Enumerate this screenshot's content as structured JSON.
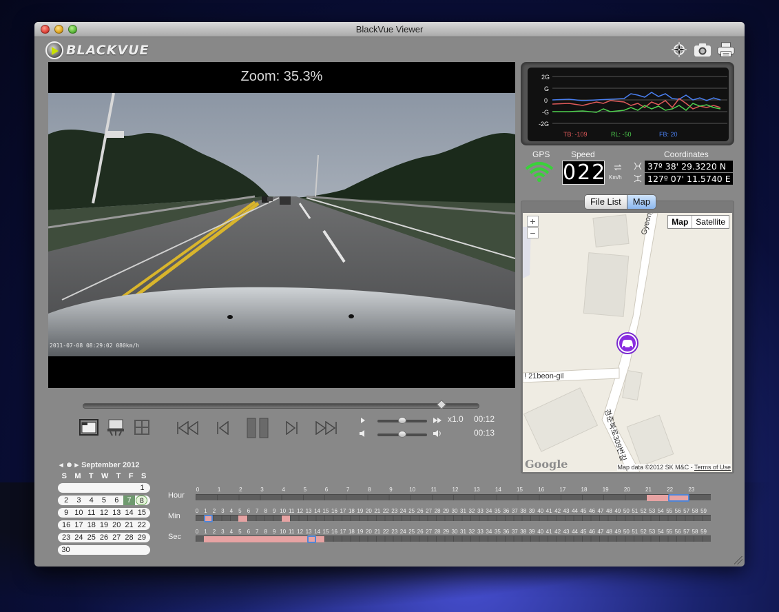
{
  "window": {
    "title": "BlackVue Viewer"
  },
  "brand": {
    "logo_text": "BLACKVUE"
  },
  "toolbar": {
    "icons": [
      "crosshair-icon",
      "camera-icon",
      "printer-icon"
    ]
  },
  "video": {
    "zoom_label": "Zoom: 35.3%",
    "overlay_stamp": "2011-07-08 08:29:02  080km/h"
  },
  "playback": {
    "position_fraction": 0.91,
    "speed_label": "x1.0",
    "current_time": "00:12",
    "total_time": "00:13",
    "speed_slider_fraction": 0.5,
    "volume_slider_fraction": 0.5
  },
  "gsensor": {
    "y_tick_labels": [
      "2G",
      "G",
      "0",
      "-G",
      "-2G"
    ],
    "readouts": [
      {
        "label": "TB: -109",
        "color": "#e05a5a"
      },
      {
        "label": "RL: -50",
        "color": "#4fcf4f"
      },
      {
        "label": "FB: 20",
        "color": "#4a7ff0"
      }
    ]
  },
  "gps": {
    "gps_label": "GPS",
    "speed_label": "Speed",
    "speed_value": "022",
    "speed_unit": "Km/h",
    "coords_label": "Coordinates",
    "latitude": "37º 38' 29.3220 N",
    "longitude": "127º 07' 11.5740 E"
  },
  "panel_tabs": {
    "file_list": "File List",
    "map": "Map",
    "active": "Map"
  },
  "map": {
    "zoom_in": "+",
    "zoom_out": "−",
    "type_map": "Map",
    "type_satellite": "Satellite",
    "street_1": "Gyeongchu",
    "street_2": "! 21beon-gil",
    "street_3": "경춘북로309번길",
    "google": "Google",
    "attribution": "Map data ©2012 SK M&C - ",
    "terms": "Terms of Use"
  },
  "calendar": {
    "month_label": "September 2012",
    "weekdays": [
      "S",
      "M",
      "T",
      "W",
      "T",
      "F",
      "S"
    ],
    "weeks": [
      [
        "",
        "",
        "",
        "",
        "",
        "",
        "1"
      ],
      [
        "2",
        "3",
        "4",
        "5",
        "6",
        "7",
        "8"
      ],
      [
        "9",
        "10",
        "11",
        "12",
        "13",
        "14",
        "15"
      ],
      [
        "16",
        "17",
        "18",
        "19",
        "20",
        "21",
        "22"
      ],
      [
        "23",
        "24",
        "25",
        "26",
        "27",
        "28",
        "29"
      ],
      [
        "30",
        "",
        "",
        "",
        "",
        "",
        ""
      ]
    ],
    "highlighted_days": [
      "7"
    ],
    "selected_day": "8"
  },
  "timeline": {
    "hour_label": "Hour",
    "min_label": "Min",
    "sec_label": "Sec",
    "hours": [
      "0",
      "1",
      "2",
      "3",
      "4",
      "5",
      "6",
      "7",
      "8",
      "9",
      "10",
      "11",
      "12",
      "13",
      "14",
      "15",
      "16",
      "17",
      "18",
      "19",
      "20",
      "21",
      "22",
      "23"
    ],
    "hours_recorded": [
      21,
      22
    ],
    "hour_selected": 22,
    "minutes_recorded": [
      1,
      5,
      10
    ],
    "minute_selected": 1,
    "seconds_recorded": [
      1,
      2,
      3,
      4,
      5,
      6,
      7,
      8,
      9,
      10,
      11,
      12,
      13,
      14
    ],
    "second_selected": 13
  },
  "colors": {
    "window_bg": "#888888",
    "recorded": "#e7a3a3",
    "selection": "#4f86d6",
    "calendar_highlight": "#6f9a6f"
  }
}
